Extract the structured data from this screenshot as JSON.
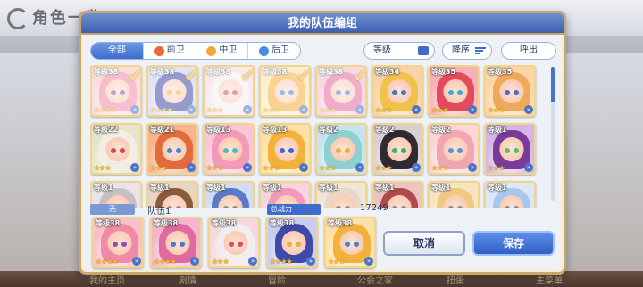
{
  "background": {
    "title": "角色一览",
    "footer_items": [
      "我的主页",
      "剧情",
      "冒险",
      "公会之家",
      "扭蛋",
      "主菜单"
    ]
  },
  "dialog": {
    "title": "我的队伍编组",
    "tabs": [
      {
        "label": "全部",
        "active": true,
        "icon": "",
        "color": ""
      },
      {
        "label": "前卫",
        "active": false,
        "icon": "vanguard-icon",
        "color": "#e8683a"
      },
      {
        "label": "中卫",
        "active": false,
        "icon": "midguard-icon",
        "color": "#f0a93a"
      },
      {
        "label": "后卫",
        "active": false,
        "icon": "rearguard-icon",
        "color": "#4a8ee0"
      }
    ],
    "level_filter": "等级",
    "sort_label": "降序",
    "call_label": "呼出",
    "characters": [
      {
        "level": "等级38",
        "stars": "★★★★",
        "selected": true,
        "hair": "#f08aa6",
        "eye": "#8a4fc0",
        "bg": "#f7c2c6"
      },
      {
        "level": "等级38",
        "stars": "★★★★",
        "selected": true,
        "hair": "#3f4aa8",
        "eye": "#e5b23a",
        "bg": "#c8ccf0"
      },
      {
        "level": "等级38",
        "stars": "★★★",
        "selected": true,
        "hair": "#f2eef0",
        "eye": "#d44a6a",
        "bg": "#f4d8dc"
      },
      {
        "level": "等级38",
        "stars": "★★★",
        "selected": true,
        "hair": "#f3b03c",
        "eye": "#3a86d8",
        "bg": "#ffe1a6"
      },
      {
        "level": "等级38",
        "stars": "★★★",
        "selected": true,
        "hair": "#e06aa0",
        "eye": "#4a7ad4",
        "bg": "#f5b6cc"
      },
      {
        "level": "等级36",
        "stars": "★★★",
        "selected": false,
        "hair": "#f0c24a",
        "eye": "#3a7ac8",
        "bg": "#f6d3a8"
      },
      {
        "level": "等级35",
        "stars": "★★★",
        "selected": false,
        "hair": "#e34a5a",
        "eye": "#3fa8d8",
        "bg": "#f7b2b8"
      },
      {
        "level": "等级35",
        "stars": "★★★",
        "selected": false,
        "hair": "#f0a95a",
        "eye": "#4a6ad0",
        "bg": "#fcd6a8"
      },
      {
        "level": "等级22",
        "stars": "★★★",
        "selected": false,
        "hair": "#f4ede4",
        "eye": "#d04a5a",
        "bg": "#e6e4c8"
      },
      {
        "level": "等级21",
        "stars": "★★★",
        "selected": false,
        "hair": "#e36a3a",
        "eye": "#3a8ad8",
        "bg": "#f7b48e"
      },
      {
        "level": "等级13",
        "stars": "★★★",
        "selected": false,
        "hair": "#f29ab8",
        "eye": "#4ac0b8",
        "bg": "#f9c6d6"
      },
      {
        "level": "等级13",
        "stars": "★★★",
        "selected": false,
        "hair": "#f2b23a",
        "eye": "#3a6ad4",
        "bg": "#fde0a6"
      },
      {
        "level": "等级2",
        "stars": "★★★",
        "selected": false,
        "hair": "#8ed0d0",
        "eye": "#e0b040",
        "bg": "#c6e4ee"
      },
      {
        "level": "等级2",
        "stars": "★★★",
        "selected": false,
        "hair": "#2e2a30",
        "eye": "#3ab06a",
        "bg": "#d8d0d4"
      },
      {
        "level": "等级2",
        "stars": "★★★",
        "selected": false,
        "hair": "#f0a6b0",
        "eye": "#4a9ad8",
        "bg": "#fbd6d8"
      },
      {
        "level": "等级1",
        "stars": "★★★",
        "selected": false,
        "hair": "#7a3a9a",
        "eye": "#5ac06a",
        "bg": "#d4b6e6"
      },
      {
        "level": "等级1",
        "stars": "",
        "selected": false,
        "hair": "#c6c0c4",
        "eye": "#888888",
        "bg": "#e8e4ea"
      },
      {
        "level": "等级1",
        "stars": "",
        "selected": false,
        "hair": "#8a5a3a",
        "eye": "#888888",
        "bg": "#e6d4c4"
      },
      {
        "level": "等级1",
        "stars": "",
        "selected": false,
        "hair": "#5a7ac8",
        "eye": "#888888",
        "bg": "#d4dcf0"
      },
      {
        "level": "等级1",
        "stars": "",
        "selected": false,
        "hair": "#f29ab8",
        "eye": "#888888",
        "bg": "#f6d4e0"
      },
      {
        "level": "等级1",
        "stars": "",
        "selected": false,
        "hair": "#e8d8c8",
        "eye": "#888888",
        "bg": "#f0e6d8"
      },
      {
        "level": "等级1",
        "stars": "",
        "selected": false,
        "hair": "#b04a4a",
        "eye": "#888888",
        "bg": "#ecc4c4"
      },
      {
        "level": "等级1",
        "stars": "",
        "selected": false,
        "hair": "#f0c880",
        "eye": "#888888",
        "bg": "#f6e4c4"
      },
      {
        "level": "等级1",
        "stars": "",
        "selected": false,
        "hair": "#a6c8f0",
        "eye": "#888888",
        "bg": "#dce8f8"
      }
    ],
    "team": {
      "none_tag": "无",
      "name": "队伍1",
      "power_label": "总战力",
      "power_value": "17249",
      "members": [
        {
          "level": "等级38",
          "stars": "★★★★",
          "hair": "#f08aa6",
          "eye": "#8a4fc0",
          "bg": "#f7c2c6"
        },
        {
          "level": "等级38",
          "stars": "★★★★",
          "hair": "#e06aa0",
          "eye": "#4a7ad4",
          "bg": "#f5b6cc"
        },
        {
          "level": "等级38",
          "stars": "★★★",
          "hair": "#f2eef0",
          "eye": "#d44a6a",
          "bg": "#f4d8dc"
        },
        {
          "level": "等级38",
          "stars": "★★★★",
          "hair": "#3f4aa8",
          "eye": "#e5b23a",
          "bg": "#c8ccf0"
        },
        {
          "level": "等级38",
          "stars": "★★★",
          "hair": "#f3b03c",
          "eye": "#3a86d8",
          "bg": "#ffe1a6"
        }
      ]
    },
    "cancel_label": "取消",
    "save_label": "保存"
  }
}
